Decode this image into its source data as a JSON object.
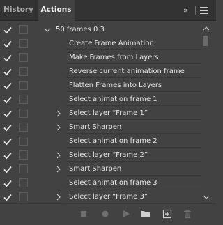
{
  "tabs": [
    {
      "label": "History",
      "active": false
    },
    {
      "label": "Actions",
      "active": true
    }
  ],
  "panel_controls": {
    "collapse_icon": "double-chevron-right-icon",
    "menu_icon": "hamburger-menu-icon"
  },
  "action_set": {
    "name": "50 frames 0.3",
    "expanded": true,
    "enabled": true
  },
  "actions": [
    {
      "label": "Create Frame Animation",
      "expandable": false,
      "enabled": true
    },
    {
      "label": "Make Frames from Layers",
      "expandable": false,
      "enabled": true
    },
    {
      "label": "Reverse current animation frame",
      "expandable": false,
      "enabled": true
    },
    {
      "label": "Flatten Frames into Layers",
      "expandable": false,
      "enabled": true
    },
    {
      "label": "Select animation frame 1",
      "expandable": false,
      "enabled": true
    },
    {
      "label": "Select layer “Frame 1”",
      "expandable": true,
      "enabled": true
    },
    {
      "label": "Smart Sharpen",
      "expandable": true,
      "enabled": true
    },
    {
      "label": "Select animation frame 2",
      "expandable": false,
      "enabled": true
    },
    {
      "label": "Select layer “Frame 2”",
      "expandable": true,
      "enabled": true
    },
    {
      "label": "Smart Sharpen",
      "expandable": true,
      "enabled": true
    },
    {
      "label": "Select animation frame 3",
      "expandable": false,
      "enabled": true
    },
    {
      "label": "Select layer “Frame 3”",
      "expandable": true,
      "enabled": true
    }
  ],
  "footer_buttons": [
    {
      "name": "stop-icon",
      "enabled": false
    },
    {
      "name": "record-icon",
      "enabled": false
    },
    {
      "name": "play-icon",
      "enabled": false
    },
    {
      "name": "new-set-folder-icon",
      "enabled": true
    },
    {
      "name": "new-action-icon",
      "enabled": true
    },
    {
      "name": "trash-icon",
      "enabled": false
    }
  ],
  "colors": {
    "panel_bg": "#424242",
    "tab_bar_bg": "#333333",
    "text": "#e8e8e8",
    "icon_disabled": "#6e6e6e",
    "icon_enabled": "#cfcfcf"
  }
}
